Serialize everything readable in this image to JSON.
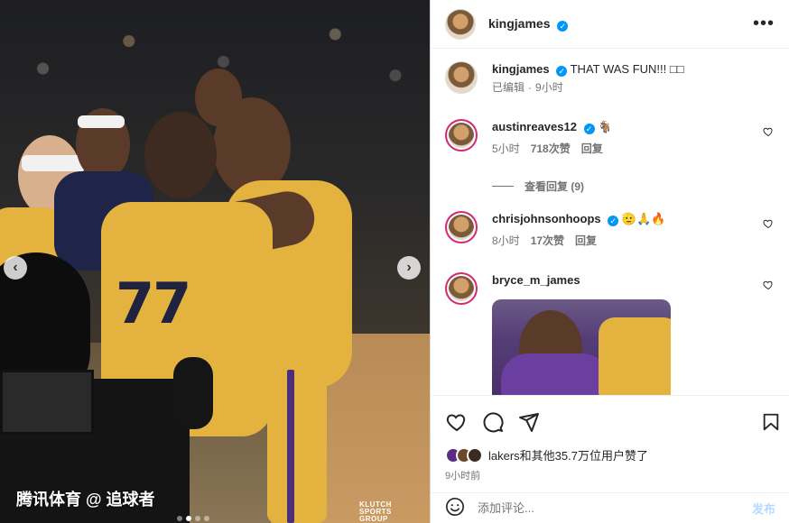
{
  "photo": {
    "watermark": "腾讯体育 @ 追球者",
    "jersey_number": "77",
    "klutch_lines": [
      "KLUTCH",
      "SPORTS",
      "GROUP"
    ],
    "prev_icon": "‹",
    "next_icon": "›",
    "colors": {
      "jersey": "#e4b23f",
      "numbers": "#1f2340"
    }
  },
  "header": {
    "username": "kingjames",
    "verified_icon": "✓",
    "more_icon": "•••"
  },
  "caption": {
    "username": "kingjames",
    "text": "THAT WAS FUN!!! □□",
    "edited": "已编辑",
    "time": "9小时"
  },
  "comments": [
    {
      "username": "austinreaves12",
      "text": "🐐",
      "time": "5小时",
      "likes": "718次赞",
      "reply": "回复",
      "view_replies": "查看回复 (9)"
    },
    {
      "username": "chrisjohnsonhoops",
      "text": "🫡🙏🔥",
      "time": "8小时",
      "likes": "17次赞",
      "reply": "回复"
    },
    {
      "username": "bryce_m_james",
      "text": ""
    }
  ],
  "likes": {
    "text": "lakers和其他35.7万位用户赞了",
    "time": "9小时前"
  },
  "add_comment": {
    "placeholder": "添加评论...",
    "post_label": "发布"
  },
  "colors": {
    "accent": "#0095f6",
    "post_disabled": "#b3dbff",
    "meta": "#737373",
    "lakers_purple": "#552583"
  }
}
